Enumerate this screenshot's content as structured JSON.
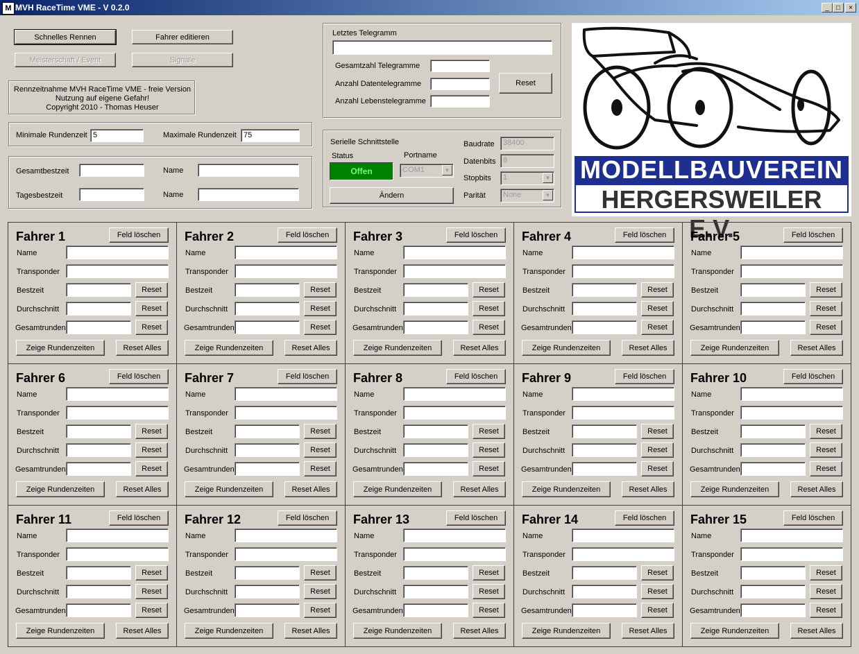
{
  "window": {
    "title": "MVH RaceTime VME - V 0.2.0",
    "minimize": "_",
    "maximize": "□",
    "close": "×",
    "app_icon": "M"
  },
  "buttons": {
    "schnelles_rennen": "Schnelles Rennen",
    "fahrer_editieren": "Fahrer editieren",
    "meisterschaft": "Meisterschaft / Event",
    "signale": "Signale"
  },
  "info": {
    "line1": "Rennzeitnahme MVH RaceTime VME - freie Version",
    "line2": "Nutzung auf eigene Gefahr!",
    "line3": "Copyright 2010 - Thomas Heuser"
  },
  "rundenzeit": {
    "min_label": "Minimale Rundenzeit",
    "min_value": "5",
    "max_label": "Maximale Rundenzeit",
    "max_value": "75"
  },
  "bestzeit": {
    "gesamt_label": "Gesamtbestzeit",
    "tages_label": "Tagesbestzeit",
    "name_label": "Name"
  },
  "telegramm": {
    "title": "Letztes Telegramm",
    "value": "",
    "gesamt_label": "Gesamtzahl Telegramme",
    "daten_label": "Anzahl Datentelegramme",
    "leben_label": "Anzahl Lebenstelegramme",
    "reset": "Reset"
  },
  "serial": {
    "title": "Serielle Schnittstelle",
    "status_label": "Status",
    "status_value": "Offen",
    "status_color": "#008000",
    "portname_label": "Portname",
    "portname_value": "COM1",
    "aendern": "Ändern",
    "baudrate_label": "Baudrate",
    "baudrate_value": "38400",
    "datenbits_label": "Datenbits",
    "datenbits_value": "8",
    "stopbits_label": "Stopbits",
    "stopbits_value": "1",
    "paritaet_label": "Parität",
    "paritaet_value": "None"
  },
  "logo": {
    "line1": "MODELLBAUVEREIN",
    "line2": "HERGERSWEILER E.V.",
    "band_color": "#1f2f8f"
  },
  "driver_labels": {
    "feld_loeschen": "Feld löschen",
    "name": "Name",
    "transponder": "Transponder",
    "bestzeit": "Bestzeit",
    "durchschnitt": "Durchschnitt",
    "gesamtrunden": "Gesamtrunden",
    "reset": "Reset",
    "zeige": "Zeige Rundenzeiten",
    "reset_alles": "Reset Alles"
  },
  "drivers": [
    {
      "title": "Fahrer 1"
    },
    {
      "title": "Fahrer 2"
    },
    {
      "title": "Fahrer 3"
    },
    {
      "title": "Fahrer 4"
    },
    {
      "title": "Fahrer 5"
    },
    {
      "title": "Fahrer 6"
    },
    {
      "title": "Fahrer 7"
    },
    {
      "title": "Fahrer 8"
    },
    {
      "title": "Fahrer 9"
    },
    {
      "title": "Fahrer 10"
    },
    {
      "title": "Fahrer 11"
    },
    {
      "title": "Fahrer 12"
    },
    {
      "title": "Fahrer 13"
    },
    {
      "title": "Fahrer 14"
    },
    {
      "title": "Fahrer 15"
    }
  ]
}
